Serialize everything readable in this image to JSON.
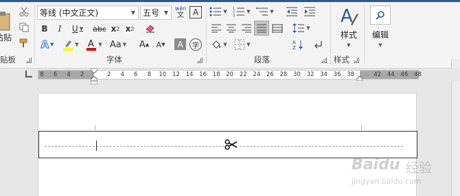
{
  "ribbon": {
    "clipboard": {
      "paste_label": "粘贴",
      "group_label": "贴板"
    },
    "font": {
      "font_name": "等线 (中文正文)",
      "font_size": "五号",
      "phonetic_top": "wén",
      "phonetic_bottom": "文",
      "bold": "B",
      "italic": "I",
      "underline": "U",
      "strikethrough": "abc",
      "subscript_base": "x",
      "subscript_sub": "2",
      "superscript_base": "x",
      "superscript_sup": "2",
      "change_case": "Aa",
      "grow": "A",
      "shrink": "A",
      "char_shading": "A",
      "enclose_char": "字",
      "group_label": "字体",
      "highlight_color": "#ffff00",
      "font_color": "#e00000"
    },
    "paragraph": {
      "group_label": "段落"
    },
    "styles": {
      "styles_label": "样式",
      "group_label": "样式"
    },
    "editing": {
      "edit_label": "编辑"
    }
  },
  "ruler": {
    "ticks": [
      "8",
      "6",
      "4",
      "2",
      "",
      "2",
      "4",
      "6",
      "8",
      "10",
      "12",
      "14",
      "16",
      "18",
      "20",
      "22",
      "24",
      "26",
      "28",
      "30",
      "32",
      "34",
      "36",
      "38",
      "",
      "42",
      "44",
      "46",
      "48"
    ]
  },
  "document": {
    "watermark_brand": "Baidu",
    "watermark_cn": "经验",
    "watermark_url": "jingyan.baidu.com"
  }
}
